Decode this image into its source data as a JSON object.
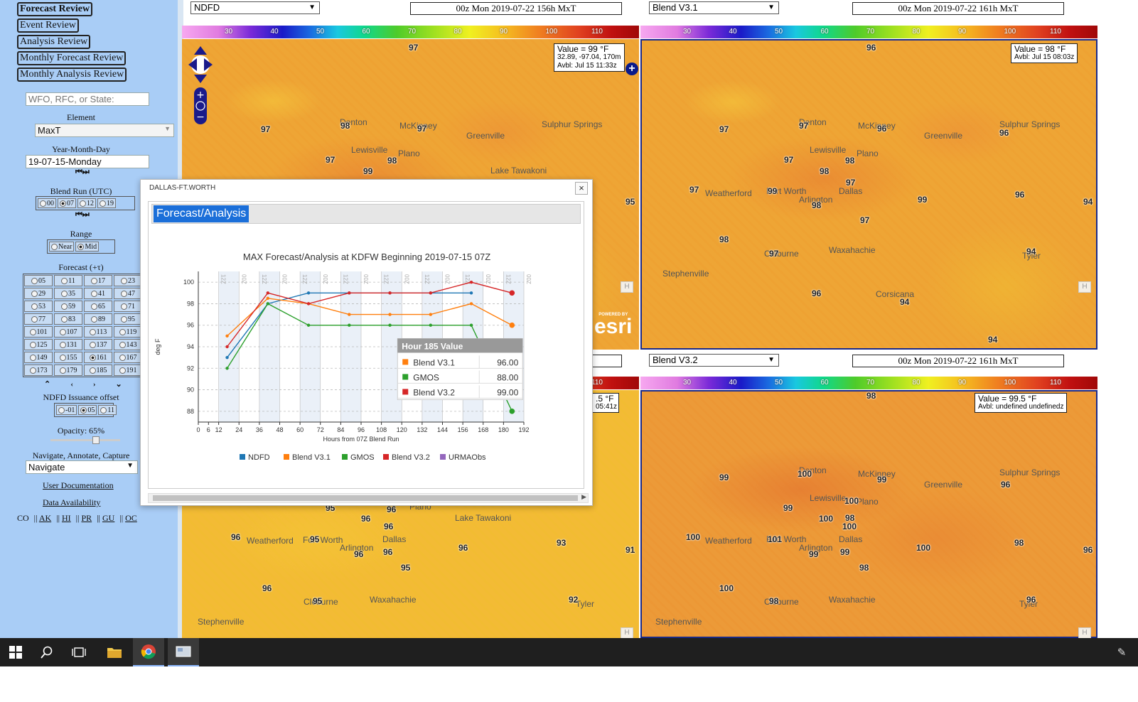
{
  "sidebar": {
    "nav_buttons": [
      "Forecast Review",
      "Event Review",
      "Analysis Review",
      "Monthly Forecast Review",
      "Monthly Analysis Review"
    ],
    "search_placeholder": "WFO, RFC, or State:",
    "element_label": "Element",
    "element_value": "MaxT",
    "date_label": "Year-Month-Day",
    "date_value": "19-07-15-Monday",
    "blend_run_label": "Blend Run (UTC)",
    "blend_runs": [
      "00",
      "07",
      "12",
      "19"
    ],
    "blend_run_selected": "07",
    "range_label": "Range",
    "ranges": [
      "Near",
      "Mid"
    ],
    "range_selected": "Mid",
    "forecast_label": "Forecast (+τ)",
    "forecast_hours": [
      "05",
      "11",
      "17",
      "23",
      "29",
      "35",
      "41",
      "47",
      "53",
      "59",
      "65",
      "71",
      "77",
      "83",
      "89",
      "95",
      "101",
      "107",
      "113",
      "119",
      "125",
      "131",
      "137",
      "143",
      "149",
      "155",
      "161",
      "167",
      "173",
      "179",
      "185",
      "191"
    ],
    "forecast_selected": "161",
    "ndfd_offset_label": "NDFD Issuance offset",
    "ndfd_offsets": [
      "-01",
      "05",
      "11"
    ],
    "ndfd_offset_selected": "05",
    "opacity_label": "Opacity: 65%",
    "opacity_value": 0.65,
    "mode_label": "Navigate, Annotate, Capture",
    "mode_value": "Navigate",
    "user_doc_link": "User Documentation",
    "data_avail_link": "Data Availability",
    "regions": [
      "CO",
      "AK",
      "HI",
      "PR",
      "GU",
      "OC"
    ]
  },
  "colorbar_ticks": [
    "30",
    "40",
    "50",
    "60",
    "70",
    "80",
    "90",
    "100",
    "110"
  ],
  "panels": {
    "top_left": {
      "model": "NDFD",
      "time": "00z Mon 2019-07-22 156h MxT",
      "value": "Value = 99 °F",
      "coords": "32.89, -97.04, 170m",
      "avbl": "Avbl: Jul 15 11:33z"
    },
    "top_right": {
      "model": "Blend V3.1",
      "time": "00z Mon 2019-07-22 161h MxT",
      "value": "Value = 98  °F",
      "avbl": "Avbl: Jul 15 08:03z"
    },
    "bottom_left": {
      "value_partial": ".5  °F",
      "avbl_partial": "05:41z"
    },
    "bottom_right": {
      "model": "Blend V3.2",
      "time": "00z Mon 2019-07-22 161h MxT",
      "value": "Value = 99.5  °F",
      "avbl": "Avbl: undefined undefinedz"
    }
  },
  "cities": {
    "top_left": [
      "Denton",
      "McKinney",
      "Greenville",
      "Lewisville",
      "Plano",
      "Sulphur Springs",
      "Lake Tawakoni"
    ],
    "top_right": [
      "Denton",
      "McKinney",
      "Greenville",
      "Lewisville",
      "Plano",
      "Weatherford",
      "Fort Worth",
      "Arlington",
      "Dallas",
      "Cleburne",
      "Waxahachie",
      "Stephenville",
      "Corsicana",
      "Tyler",
      "Sulphur Springs"
    ],
    "bottom_left": [
      "Weatherford",
      "Fort Worth",
      "Arlington",
      "Dallas",
      "Cleburne",
      "Waxahachie",
      "Stephenville",
      "Tyler",
      "Lake Tawakoni",
      "Plano"
    ],
    "bottom_right": [
      "Denton",
      "McKinney",
      "Greenville",
      "Lewisville",
      "Plano",
      "Weatherford",
      "Fort Worth",
      "Arlington",
      "Dallas",
      "Cleburne",
      "Waxahachie",
      "Stephenville",
      "Tyler",
      "Sulphur Springs"
    ]
  },
  "map_values": {
    "top_left": [
      "97",
      "97",
      "98",
      "97",
      "97",
      "98",
      "99",
      "95"
    ],
    "top_right": [
      "96",
      "97",
      "97",
      "96",
      "96",
      "97",
      "98",
      "98",
      "97",
      "99",
      "96",
      "94",
      "98",
      "97",
      "97",
      "98",
      "97",
      "96",
      "94",
      "94",
      "94",
      "99"
    ],
    "bottom_left": [
      "96",
      "95",
      "96",
      "96",
      "96",
      "96",
      "95",
      "96",
      "95",
      "96",
      "93",
      "91",
      "92",
      "95",
      "96"
    ],
    "bottom_right": [
      "98",
      "99",
      "100",
      "99",
      "98",
      "99",
      "100",
      "100",
      "100",
      "101",
      "99",
      "99",
      "100",
      "100",
      "98",
      "98",
      "96",
      "100",
      "98",
      "96",
      "96"
    ]
  },
  "esri_label": "esri",
  "esri_powered": "POWERED BY",
  "dialog": {
    "title": "DALLAS-FT.WORTH",
    "tab": "Forecast/Analysis",
    "close": "×"
  },
  "chart_data": {
    "type": "line",
    "title": "MAX Forecast/Analysis at KDFW Beginning 2019-07-15 07Z",
    "xlabel": "Hours from 07Z Blend Run",
    "ylabel": "deg F",
    "xlim": [
      0,
      192
    ],
    "ylim": [
      87,
      101
    ],
    "x_ticks": [
      0,
      6,
      12,
      24,
      36,
      48,
      60,
      72,
      84,
      96,
      108,
      120,
      132,
      144,
      156,
      168,
      180,
      192
    ],
    "y_ticks": [
      88,
      90,
      92,
      94,
      96,
      98,
      100
    ],
    "band_labels": [
      "12Z",
      "00Z"
    ],
    "series": [
      {
        "name": "NDFD",
        "color": "#1f77b4",
        "x": [
          17,
          41,
          65,
          89,
          113,
          137,
          161
        ],
        "y": [
          93,
          98,
          99,
          99,
          99,
          99,
          99
        ]
      },
      {
        "name": "Blend V3.1",
        "color": "#ff7f0e",
        "x": [
          17,
          41,
          65,
          89,
          113,
          137,
          161,
          185
        ],
        "y": [
          95,
          98.5,
          98,
          97,
          97,
          97,
          98,
          96
        ]
      },
      {
        "name": "GMOS",
        "color": "#2ca02c",
        "x": [
          17,
          41,
          65,
          89,
          113,
          137,
          161,
          185
        ],
        "y": [
          92,
          98,
          96,
          96,
          96,
          96,
          96,
          88
        ]
      },
      {
        "name": "Blend V3.2",
        "color": "#d62728",
        "x": [
          17,
          41,
          65,
          89,
          113,
          137,
          161,
          185
        ],
        "y": [
          94,
          99,
          98,
          99,
          99,
          99,
          100,
          99
        ]
      },
      {
        "name": "URMAObs",
        "color": "#9467bd",
        "x": [],
        "y": []
      }
    ],
    "tooltip": {
      "title": "Hour 185 Value",
      "rows": [
        {
          "name": "Blend V3.1",
          "value": "96.00",
          "color": "#ff7f0e"
        },
        {
          "name": "GMOS",
          "value": "88.00",
          "color": "#2ca02c"
        },
        {
          "name": "Blend V3.2",
          "value": "99.00",
          "color": "#d62728"
        }
      ]
    },
    "legend_position": "bottom",
    "grid": true
  },
  "taskbar": {
    "items": [
      "windows-start",
      "search",
      "task-view",
      "file-explorer",
      "chrome",
      "app"
    ]
  }
}
